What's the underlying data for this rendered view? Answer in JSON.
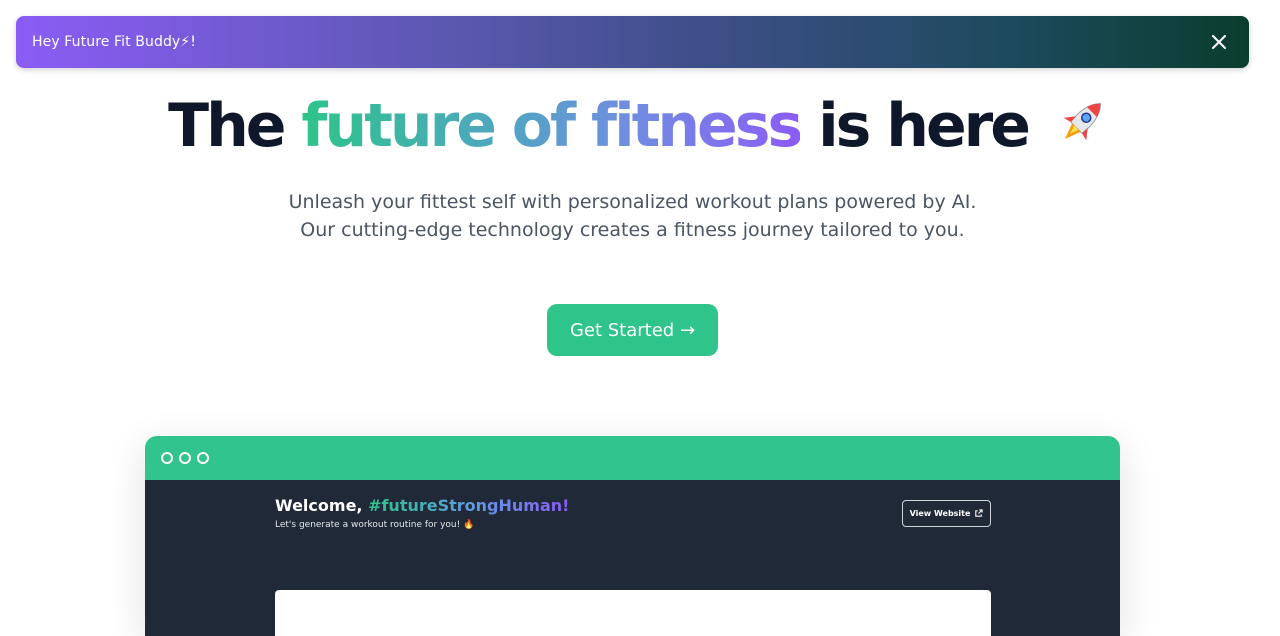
{
  "banner": {
    "text": "Hey Future Fit Buddy⚡!",
    "close_icon": "close-icon",
    "gradient_start": "#8b5cf6",
    "gradient_end": "#0b3d2e"
  },
  "hero": {
    "title_part1": "The ",
    "title_highlight": "future of fitness",
    "title_part2": " is here",
    "title_icon": "rocket-icon",
    "subtitle": "Unleash your fittest self with personalized workout plans powered by AI. Our cutting-edge technology creates a fitness journey tailored to you.",
    "cta_label": "Get Started →"
  },
  "preview": {
    "welcome_prefix": "Welcome, ",
    "welcome_tag": "#futureStrongHuman!",
    "welcome_sub": "Let's generate a workout routine for you! 🔥",
    "view_website_label": "View Website",
    "view_website_icon": "external-link-icon"
  },
  "colors": {
    "accent": "#2ec48a",
    "dark_panel": "#1f2937",
    "heading": "#0f172a",
    "body_text": "#4b5563"
  }
}
